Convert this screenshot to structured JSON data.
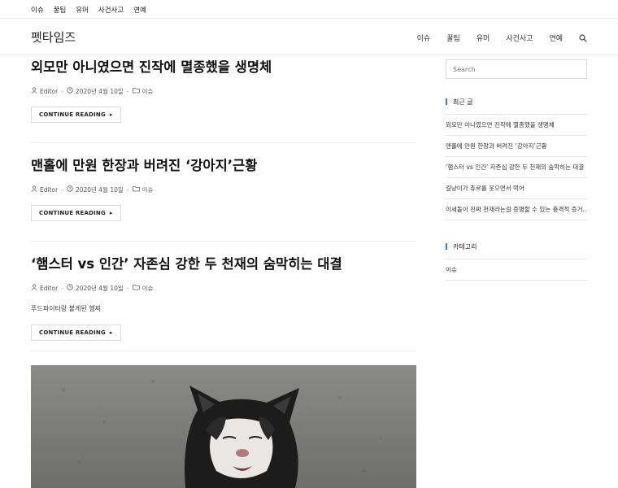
{
  "topbar": {
    "items": [
      "이슈",
      "꿀팁",
      "유머",
      "사건사고",
      "연예"
    ]
  },
  "header": {
    "site_title": "펫타임즈",
    "nav": [
      "이슈",
      "꿀팁",
      "유머",
      "사건사고",
      "연예"
    ],
    "search_icon": "search-icon"
  },
  "posts": [
    {
      "title": "외모만 아니였으면 진작에 멸종했을 생명체",
      "author": "Editor",
      "date": "2020년 4월 10일",
      "category": "이슈",
      "excerpt": "",
      "read_more": "CONTINUE READING"
    },
    {
      "title": "맨홀에 만원 한장과 버려진 ‘강아지’근황",
      "author": "Editor",
      "date": "2020년 4월 10일",
      "category": "이슈",
      "excerpt": "",
      "read_more": "CONTINUE READING"
    },
    {
      "title": "‘햄스터 vs 인간’ 자존심 강한 두 천재의 숨막히는 대결",
      "author": "Editor",
      "date": "2020년 4월 10일",
      "category": "이슈",
      "excerpt": "푸드파이터랑 붙게된 햄찌",
      "read_more": "CONTINUE READING"
    }
  ],
  "sidebar": {
    "search_placeholder": "Search",
    "recent_title": "최근 글",
    "recent_posts": [
      "외모만 아니였으면 진작에 멸종했을 생명체",
      "맨홀에 만원 한장과 버려진 ‘강아지’근황",
      "‘햄스터 vs 인간’ 자존심 강한 두 천재의 숨막히는 대결",
      "길냥이가 츄르를 웃으면서 먹어",
      "이세돌이 진짜 천재라는걸 증명할 수 있는 충격적 증거.."
    ],
    "category_title": "카테고리",
    "categories": [
      "이슈"
    ]
  },
  "colors": {
    "accent": "#3b7ad6"
  }
}
